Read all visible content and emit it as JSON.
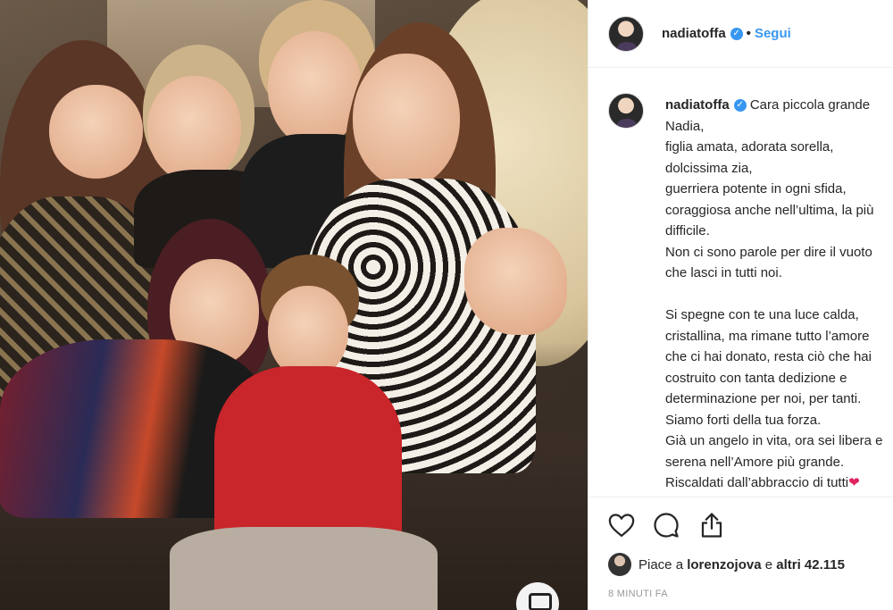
{
  "post": {
    "username": "nadiatoffa",
    "dot": "•",
    "follow_label": "Segui"
  },
  "caption": {
    "username": "nadiatoffa",
    "lines": [
      "Cara piccola grande",
      "Nadia,",
      "figlia amata, adorata sorella,",
      "dolcissima zia,",
      "guerriera potente in ogni sfida,",
      "coraggiosa anche nell’ultima, la più",
      "difficile.",
      "Non ci sono parole per dire il vuoto",
      "che lasci in tutti noi.",
      "",
      "Si spegne con te una luce calda,",
      "cristallina, ma rimane tutto l’amore",
      "che ci hai donato, resta ciò che hai",
      "costruito con tanta dedizione e",
      "determinazione per noi, per tanti.",
      "Siamo forti della tua forza.",
      "Già un angelo in vita, ora sei libera e",
      "serena nell’Amore più grande.",
      "Riscaldati dall’abbraccio di tutti"
    ],
    "end_emoji": "❤"
  },
  "actions": {
    "like_icon": "heart-icon",
    "comment_icon": "comment-icon",
    "share_icon": "share-icon"
  },
  "likes": {
    "prefix": "Piace a ",
    "user": "lorenzojova",
    "middle": " e ",
    "others": "altri 42.115"
  },
  "timestamp": "8 MINUTI FA",
  "colors": {
    "accent": "#3897f0",
    "text": "#262626",
    "muted": "#999999",
    "border": "#efefef"
  }
}
